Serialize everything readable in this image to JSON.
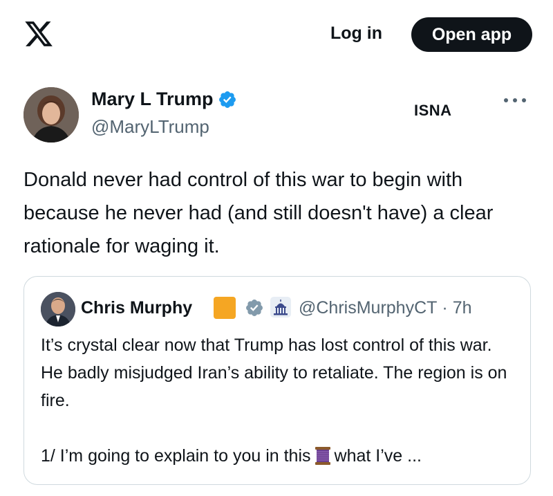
{
  "header": {
    "logo_icon": "x-logo-icon",
    "login_label": "Log in",
    "open_app_label": "Open app"
  },
  "tweet": {
    "author_name": "Mary L Trump",
    "author_handle": "@MaryLTrump",
    "verified_icon": "verified-badge-icon",
    "watermark": "ISNA",
    "more_icon": "more-icon",
    "text": "Donald never had control of this war to begin with because he never had (and still doesn't have) a clear rationale for waging it."
  },
  "quoted_tweet": {
    "author_name": "Chris Murphy",
    "author_handle": "@ChrisMurphyCT",
    "separator": "·",
    "time": "7h",
    "badges": [
      "orange-square-icon",
      "gray-verified-badge-icon",
      "capitol-building-icon"
    ],
    "text": "It’s crystal clear now that Trump has lost control of this war. He badly misjudged Iran’s ability to retaliate. The region is on fire.",
    "thread_before": "1/ I’m going to explain to you in this",
    "thread_icon": "spool-of-thread-icon",
    "thread_after": "what I’ve ..."
  },
  "colors": {
    "text": "#0f1419",
    "secondary": "#536471",
    "verified_blue": "#1d9bf0",
    "button_bg": "#0f1419",
    "border": "#cfd9de",
    "orange_badge": "#f5a623"
  }
}
